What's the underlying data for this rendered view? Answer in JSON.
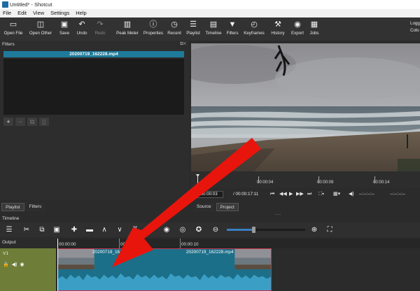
{
  "window": {
    "title": "Untitled* - Shotcut"
  },
  "menu": [
    {
      "label": "File"
    },
    {
      "label": "Edit"
    },
    {
      "label": "View"
    },
    {
      "label": "Settings"
    },
    {
      "label": "Help"
    }
  ],
  "toolbar": {
    "items": [
      {
        "label": "Open File",
        "icon": "open-file-icon"
      },
      {
        "label": "Open Other",
        "icon": "open-other-icon"
      },
      {
        "label": "Save",
        "icon": "save-icon"
      },
      {
        "label": "Undo",
        "icon": "undo-icon"
      },
      {
        "label": "Redo",
        "icon": "redo-icon"
      },
      {
        "label": "Peak Meter",
        "icon": "peak-meter-icon"
      },
      {
        "label": "Properties",
        "icon": "properties-icon"
      },
      {
        "label": "Recent",
        "icon": "recent-icon"
      },
      {
        "label": "Playlist",
        "icon": "playlist-icon"
      },
      {
        "label": "Timeline",
        "icon": "timeline-icon"
      },
      {
        "label": "Filters",
        "icon": "filters-icon"
      },
      {
        "label": "Keyframes",
        "icon": "keyframes-icon"
      },
      {
        "label": "History",
        "icon": "history-icon"
      },
      {
        "label": "Export",
        "icon": "export-icon"
      },
      {
        "label": "Jobs",
        "icon": "jobs-icon"
      }
    ],
    "right_top": "Logg",
    "right_bottom": "Colo"
  },
  "filters": {
    "header": "Filters",
    "clip_name": "20200719_162228.mp4"
  },
  "player": {
    "ticks": [
      "00:00:00",
      "00:00:04",
      "00:00:09",
      "00:00:14"
    ],
    "current_time": "00:00:00:03",
    "total_time": "/ 00:00:17:11",
    "in_point": "--:--:--:--",
    "out_point": "--:--:--:--"
  },
  "tabs_left": [
    {
      "label": "Playlist"
    },
    {
      "label": "Filters"
    }
  ],
  "tabs_right": [
    {
      "label": "Source"
    },
    {
      "label": "Project"
    }
  ],
  "timeline": {
    "label": "Timeline",
    "output_label": "Output",
    "track_label": "V1",
    "ruler_ticks": [
      "00:00:00",
      "00:00:05",
      "00:00:10"
    ],
    "clip_name": "20200719_162228.mp4",
    "clip_name_short": "20200719_16"
  },
  "colors": {
    "accent": "#1e7a9a",
    "clip_border": "#c2334d",
    "track_head": "#6e7e38",
    "arrow": "#e8150d"
  }
}
